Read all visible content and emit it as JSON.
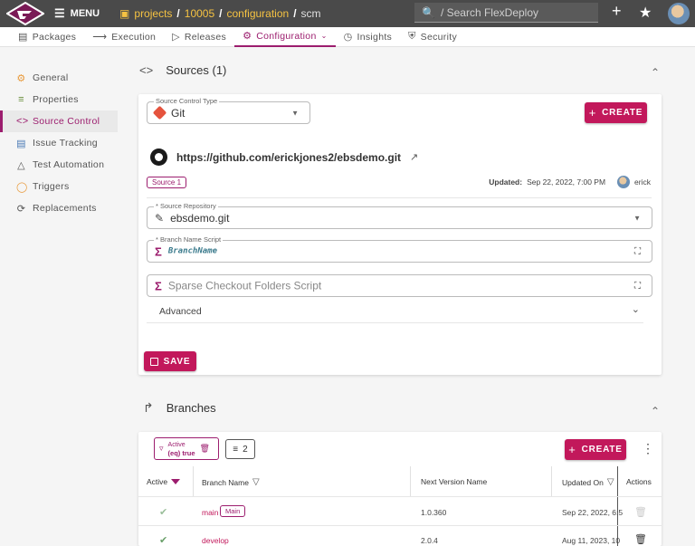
{
  "topbar": {
    "menu_label": "MENU",
    "breadcrumb": [
      "projects",
      "10005",
      "configuration",
      "scm"
    ],
    "search_placeholder": "/ Search FlexDeploy"
  },
  "tabs": [
    {
      "label": "Packages",
      "icon": "package-icon"
    },
    {
      "label": "Execution",
      "icon": "run-icon"
    },
    {
      "label": "Releases",
      "icon": "release-icon"
    },
    {
      "label": "Configuration",
      "icon": "gear-icon",
      "active": true
    },
    {
      "label": "Insights",
      "icon": "insights-icon"
    },
    {
      "label": "Security",
      "icon": "shield-icon"
    }
  ],
  "leftnav": [
    {
      "label": "General",
      "icon": "gear-icon"
    },
    {
      "label": "Properties",
      "icon": "list-icon"
    },
    {
      "label": "Source Control",
      "icon": "code-icon",
      "active": true
    },
    {
      "label": "Issue Tracking",
      "icon": "clipboard-icon"
    },
    {
      "label": "Test Automation",
      "icon": "flask-icon"
    },
    {
      "label": "Triggers",
      "icon": "trigger-icon"
    },
    {
      "label": "Replacements",
      "icon": "replace-icon"
    }
  ],
  "sources": {
    "title": "Sources (1)",
    "source_control_type_label": "Source Control Type",
    "source_control_type_value": "Git",
    "create_label": "CREATE",
    "repo_url": "https://github.com/erickjones2/ebsdemo.git",
    "source_tag": "Source 1",
    "updated_label": "Updated:",
    "updated_value": "Sep 22, 2022, 7:00 PM",
    "updated_user": "erick",
    "repo_label": "* Source Repository",
    "repo_value": "ebsdemo.git",
    "branch_script_label": "* Branch Name Script",
    "branch_script_value": "BranchName",
    "sparse_placeholder": "Sparse Checkout Folders Script",
    "advanced_label": "Advanced",
    "save_label": "SAVE"
  },
  "branches": {
    "title": "Branches",
    "filter_chip_line1": "Active",
    "filter_chip_line2": "(eq) true",
    "sort_count": "2",
    "create_label": "CREATE",
    "columns": [
      "Active",
      "Branch Name",
      "Next Version Name",
      "Updated On",
      "Actions"
    ],
    "rows": [
      {
        "name": "main",
        "tag": "Main",
        "version": "1.0.360",
        "updated": "Sep 22, 2022, 6:5"
      },
      {
        "name": "develop",
        "tag": "",
        "version": "2.0.4",
        "updated": "Aug 11, 2023, 10"
      }
    ]
  },
  "colors": {
    "accent": "#9c1d6e",
    "button": "#c2185b",
    "topbar": "#4a4a4a",
    "breadcrumb_link": "#f5c242"
  }
}
